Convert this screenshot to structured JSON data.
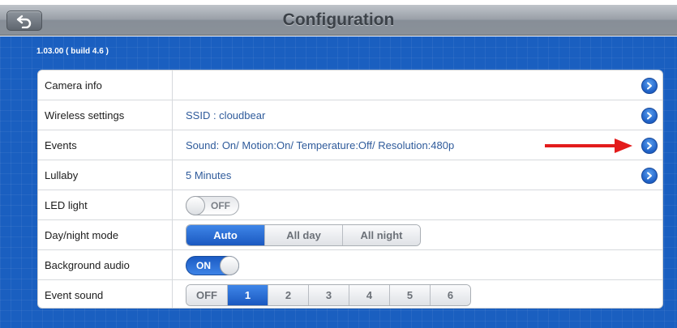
{
  "header": {
    "title": "Configuration",
    "back_icon": "back-arrow-icon"
  },
  "version": "1.03.00 ( build 4.6 )",
  "rows": [
    {
      "label": "Camera info",
      "value": "",
      "chevron": true
    },
    {
      "label": "Wireless settings",
      "value": "SSID : cloudbear",
      "chevron": true
    },
    {
      "label": "Events",
      "value": "Sound: On/ Motion:On/ Temperature:Off/ Resolution:480p",
      "chevron": true
    },
    {
      "label": "Lullaby",
      "value": "5 Minutes",
      "chevron": true
    },
    {
      "label": "LED light",
      "toggle": {
        "state": "off",
        "text": "OFF"
      }
    },
    {
      "label": "Day/night mode",
      "options": [
        "Auto",
        "All day",
        "All night"
      ],
      "selected": "Auto"
    },
    {
      "label": "Background audio",
      "toggle": {
        "state": "on",
        "text": "ON"
      }
    },
    {
      "label": "Event sound",
      "options": [
        "OFF",
        "1",
        "2",
        "3",
        "4",
        "5",
        "6"
      ],
      "selected": "1"
    }
  ],
  "annotation": {
    "type": "red-arrow",
    "points_to": "events-chevron",
    "color": "#e31b1b"
  },
  "colors": {
    "accent": "#1a5fc0",
    "value_text": "#2f5b9b",
    "title_text": "#3c4249"
  }
}
